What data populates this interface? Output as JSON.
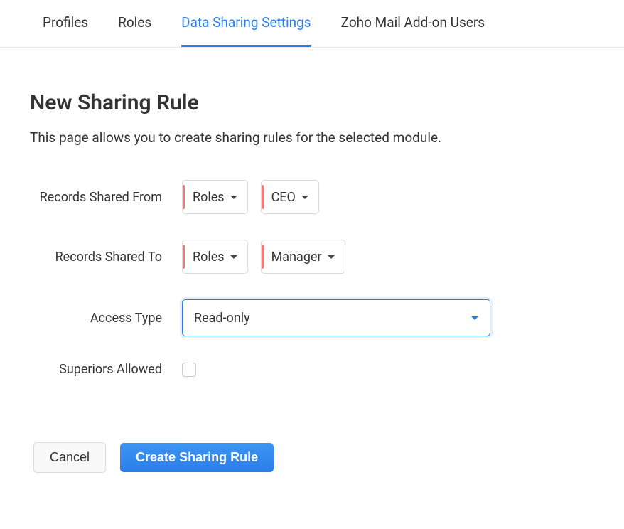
{
  "tabs": [
    {
      "label": "Profiles",
      "active": false
    },
    {
      "label": "Roles",
      "active": false
    },
    {
      "label": "Data Sharing Settings",
      "active": true
    },
    {
      "label": "Zoho Mail Add-on Users",
      "active": false
    }
  ],
  "page": {
    "title": "New Sharing Rule",
    "description": "This page allows you to create sharing rules for the selected module."
  },
  "form": {
    "shared_from": {
      "label": "Records Shared From",
      "type_value": "Roles",
      "role_value": "CEO"
    },
    "shared_to": {
      "label": "Records Shared To",
      "type_value": "Roles",
      "role_value": "Manager"
    },
    "access_type": {
      "label": "Access Type",
      "value": "Read-only"
    },
    "superiors": {
      "label": "Superiors Allowed",
      "checked": false
    }
  },
  "actions": {
    "cancel": "Cancel",
    "create": "Create Sharing Rule"
  }
}
